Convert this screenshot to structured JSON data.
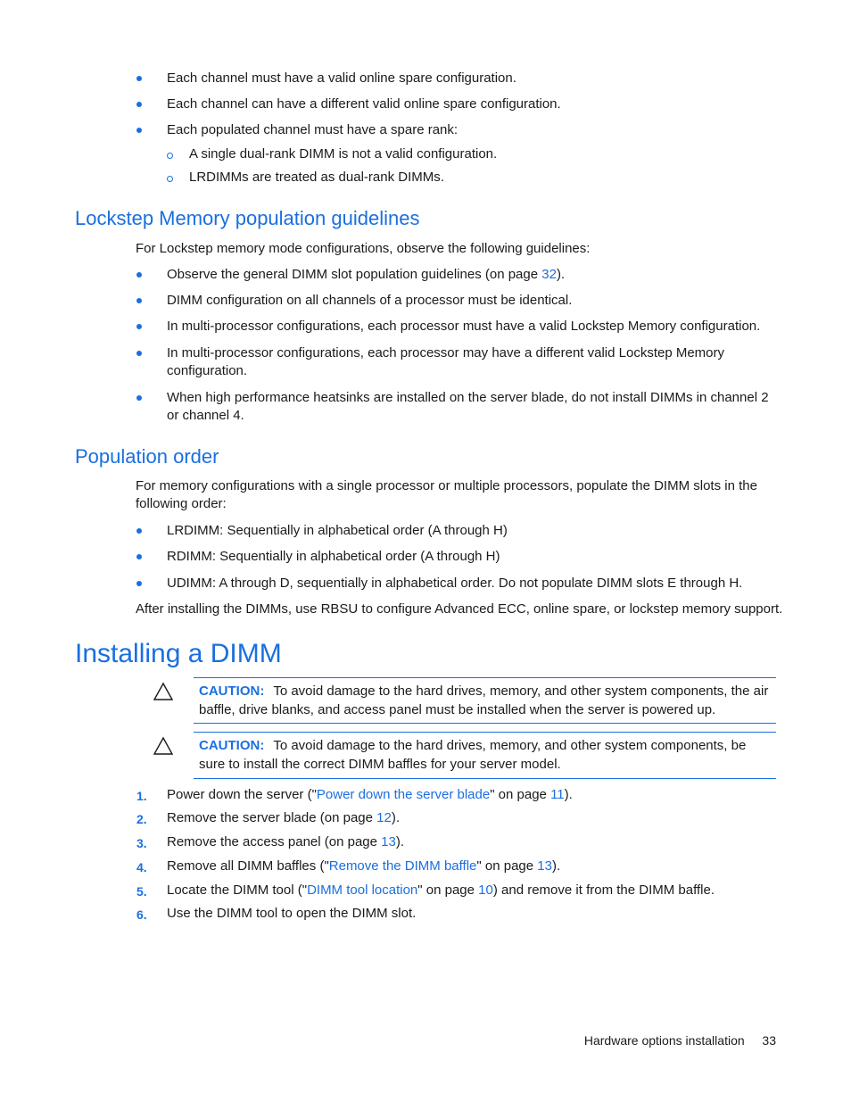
{
  "top_list": {
    "items": [
      "Each channel must have a valid online spare configuration.",
      "Each channel can have a different valid online spare configuration.",
      "Each populated channel must have a spare rank:"
    ],
    "sub_items": [
      "A single dual-rank DIMM is not a valid configuration.",
      "LRDIMMs are treated as dual-rank DIMMs."
    ]
  },
  "lockstep": {
    "heading": "Lockstep Memory population guidelines",
    "intro": "For Lockstep memory mode configurations, observe the following guidelines:",
    "item1_before": "Observe the general DIMM slot population guidelines (on page ",
    "item1_link": "32",
    "item1_after": ").",
    "items": [
      "DIMM configuration on all channels of a processor must be identical.",
      "In multi-processor configurations, each processor must have a valid Lockstep Memory configuration.",
      "In multi-processor configurations, each processor may have a different valid Lockstep Memory configuration.",
      "When high performance heatsinks are installed on the server blade, do not install DIMMs in channel 2 or channel 4."
    ]
  },
  "population": {
    "heading": "Population order",
    "intro": "For memory configurations with a single processor or multiple processors, populate the DIMM slots in the following order:",
    "items": [
      "LRDIMM: Sequentially in alphabetical order (A through H)",
      "RDIMM: Sequentially in alphabetical order (A through H)",
      "UDIMM: A through D, sequentially in alphabetical order. Do not populate DIMM slots E through H."
    ],
    "after": "After installing the DIMMs, use RBSU to configure Advanced ECC, online spare, or lockstep memory support."
  },
  "installing": {
    "heading": "Installing a DIMM",
    "cautions": [
      {
        "label": "CAUTION:",
        "text": "To avoid damage to the hard drives, memory, and other system components, the air baffle, drive blanks, and access panel must be installed when the server is powered up."
      },
      {
        "label": "CAUTION:",
        "text": "To avoid damage to the hard drives, memory, and other system components, be sure to install the correct DIMM baffles for your server model."
      }
    ],
    "steps": [
      {
        "num": "1.",
        "before": "Power down the server (\"",
        "link": "Power down the server blade",
        "mid": "\" on page ",
        "page": "11",
        "after": ")."
      },
      {
        "num": "2.",
        "before": "Remove the server blade (on page ",
        "page": "12",
        "after": ")."
      },
      {
        "num": "3.",
        "before": "Remove the access panel (on page ",
        "page": "13",
        "after": ")."
      },
      {
        "num": "4.",
        "before": "Remove all DIMM baffles (\"",
        "link": "Remove the DIMM baffle",
        "mid": "\" on page ",
        "page": "13",
        "after": ")."
      },
      {
        "num": "5.",
        "before": "Locate the DIMM tool (\"",
        "link": "DIMM tool location",
        "mid": "\" on page ",
        "page": "10",
        "after": ") and remove it from the DIMM baffle."
      },
      {
        "num": "6.",
        "before": "Use the DIMM tool to open the DIMM slot."
      }
    ]
  },
  "footer": {
    "section": "Hardware options installation",
    "page": "33"
  }
}
